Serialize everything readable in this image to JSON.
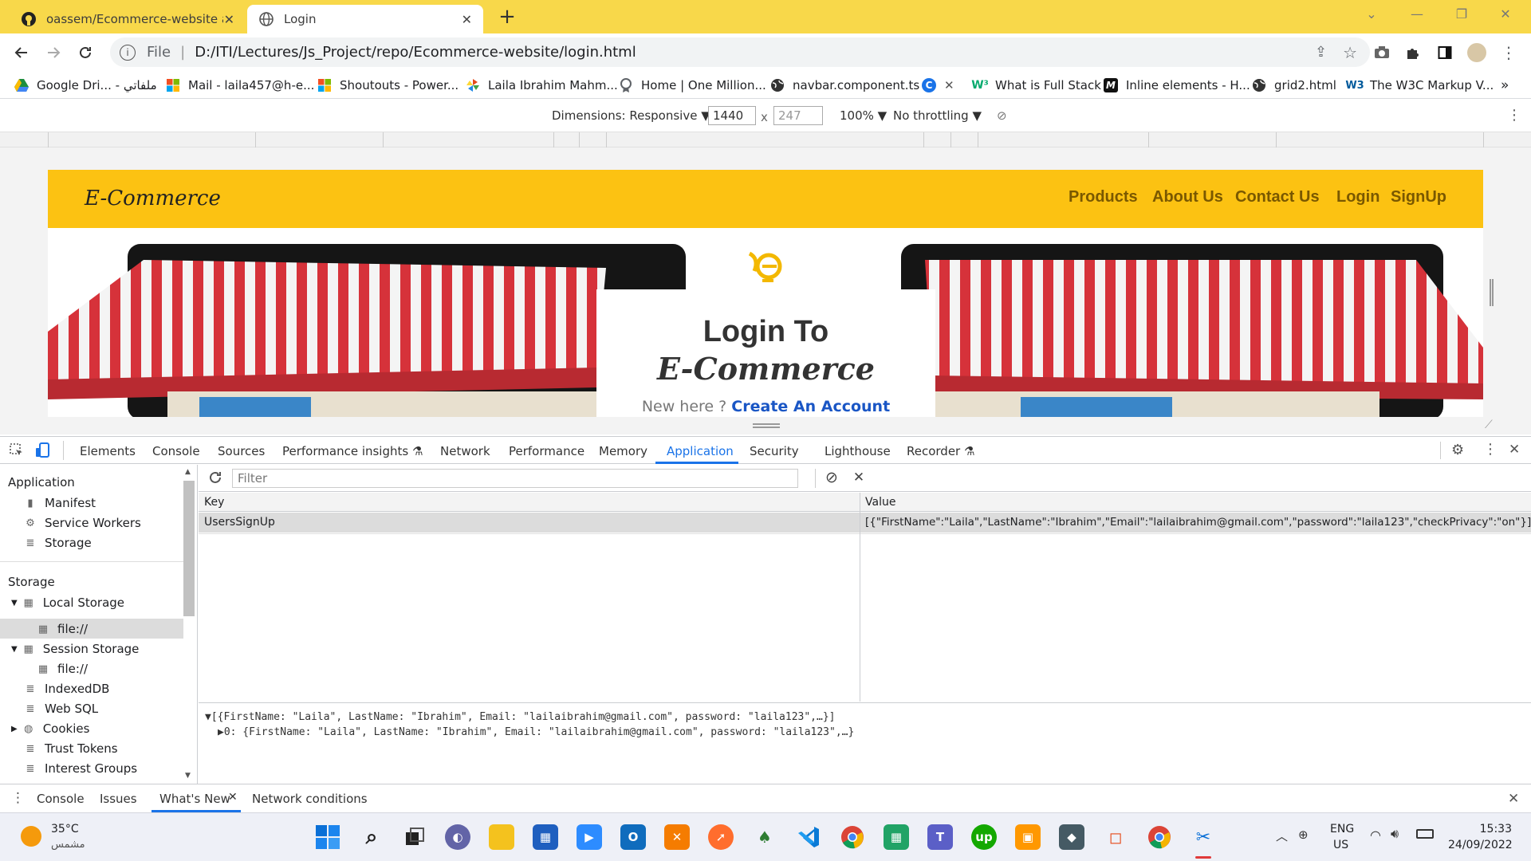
{
  "browser": {
    "tabs": [
      {
        "title": "oassem/Ecommerce-website at s",
        "icon": "github-icon"
      },
      {
        "title": "Login",
        "icon": "globe-icon"
      }
    ],
    "new_tab_label": "+",
    "address": {
      "scheme_label": "File",
      "path": "D:/ITI/Lectures/Js_Project/repo/Ecommerce-website/login.html"
    },
    "bookmarks": [
      {
        "label": "Google Dri... - ملفاتي",
        "icon": "google-drive-icon",
        "color": "#1e8e3e"
      },
      {
        "label": "Mail - laila457@h-e...",
        "icon": "microsoft-icon",
        "color": "#f25022"
      },
      {
        "label": "Shoutouts - Power...",
        "icon": "microsoft-icon",
        "color": "#7fba00"
      },
      {
        "label": "Laila Ibrahim Mahm...",
        "icon": "pinwheel-icon",
        "color": "#e64a19"
      },
      {
        "label": "Home | One Million...",
        "icon": "badge-icon",
        "color": "#5f6368"
      },
      {
        "label": "navbar.component.ts",
        "icon": "globe-icon",
        "color": "#3c3c3c"
      },
      {
        "label": "",
        "icon": "c-icon",
        "color": "#1a73e8"
      },
      {
        "label": "What is Full Stack",
        "icon": "w3-icon",
        "color": "#04aa6d"
      },
      {
        "label": "Inline elements - H...",
        "icon": "mdn-icon",
        "color": "#111111"
      },
      {
        "label": "grid2.html",
        "icon": "globe-icon",
        "color": "#3c3c3c"
      },
      {
        "label": "The W3C Markup V...",
        "icon": "w3c-icon",
        "color": "#005a9c"
      }
    ],
    "more_bookmarks": "»"
  },
  "device_toolbar": {
    "dimensions_label": "Dimensions: Responsive ▼",
    "width": "1440",
    "times": "x",
    "height": "247",
    "zoom": "100% ▼",
    "throttling": "No throttling ▼"
  },
  "site": {
    "logo": "E-Commerce",
    "nav": [
      "Products",
      "About Us",
      "Contact Us",
      "Login",
      "SignUp"
    ],
    "login_title": "Login To",
    "login_brand": "E-Commerce",
    "new_here": "New here ?",
    "create_account": "Create An Account",
    "accent": "#fcc212"
  },
  "devtools": {
    "tabs": [
      "Elements",
      "Console",
      "Sources",
      "Performance insights",
      "Network",
      "Performance",
      "Memory",
      "Application",
      "Security",
      "Lighthouse",
      "Recorder"
    ],
    "active_tab": "Application",
    "sidebar": {
      "application_header": "Application",
      "application_items": [
        "Manifest",
        "Service Workers",
        "Storage"
      ],
      "storage_header": "Storage",
      "local_storage": "Local Storage",
      "local_storage_child": "file://",
      "session_storage": "Session Storage",
      "session_storage_child": "file://",
      "other_items": [
        "IndexedDB",
        "Web SQL",
        "Cookies",
        "Trust Tokens",
        "Interest Groups"
      ]
    },
    "filter_placeholder": "Filter",
    "table": {
      "columns": [
        "Key",
        "Value"
      ],
      "rows": [
        {
          "key": "UsersSignUp",
          "value": "[{\"FirstName\":\"Laila\",\"LastName\":\"Ibrahim\",\"Email\":\"lailaibrahim@gmail.com\",\"password\":\"laila123\",\"checkPrivacy\":\"on\"}]"
        }
      ]
    },
    "preview": {
      "line1": "▼[{FirstName: \"Laila\", LastName: \"Ibrahim\", Email: \"lailaibrahim@gmail.com\", password: \"laila123\",…}]",
      "line2": "▶0: {FirstName: \"Laila\", LastName: \"Ibrahim\", Email: \"lailaibrahim@gmail.com\", password: \"laila123\",…}"
    },
    "drawer_tabs": [
      "Console",
      "Issues",
      "What's New",
      "Network conditions"
    ],
    "drawer_active": "What's New"
  },
  "taskbar": {
    "weather_temp": "35°C",
    "weather_desc": "مشمس",
    "lang_top": "ENG",
    "lang_bottom": "US",
    "time": "15:33",
    "date": "24/09/2022"
  }
}
